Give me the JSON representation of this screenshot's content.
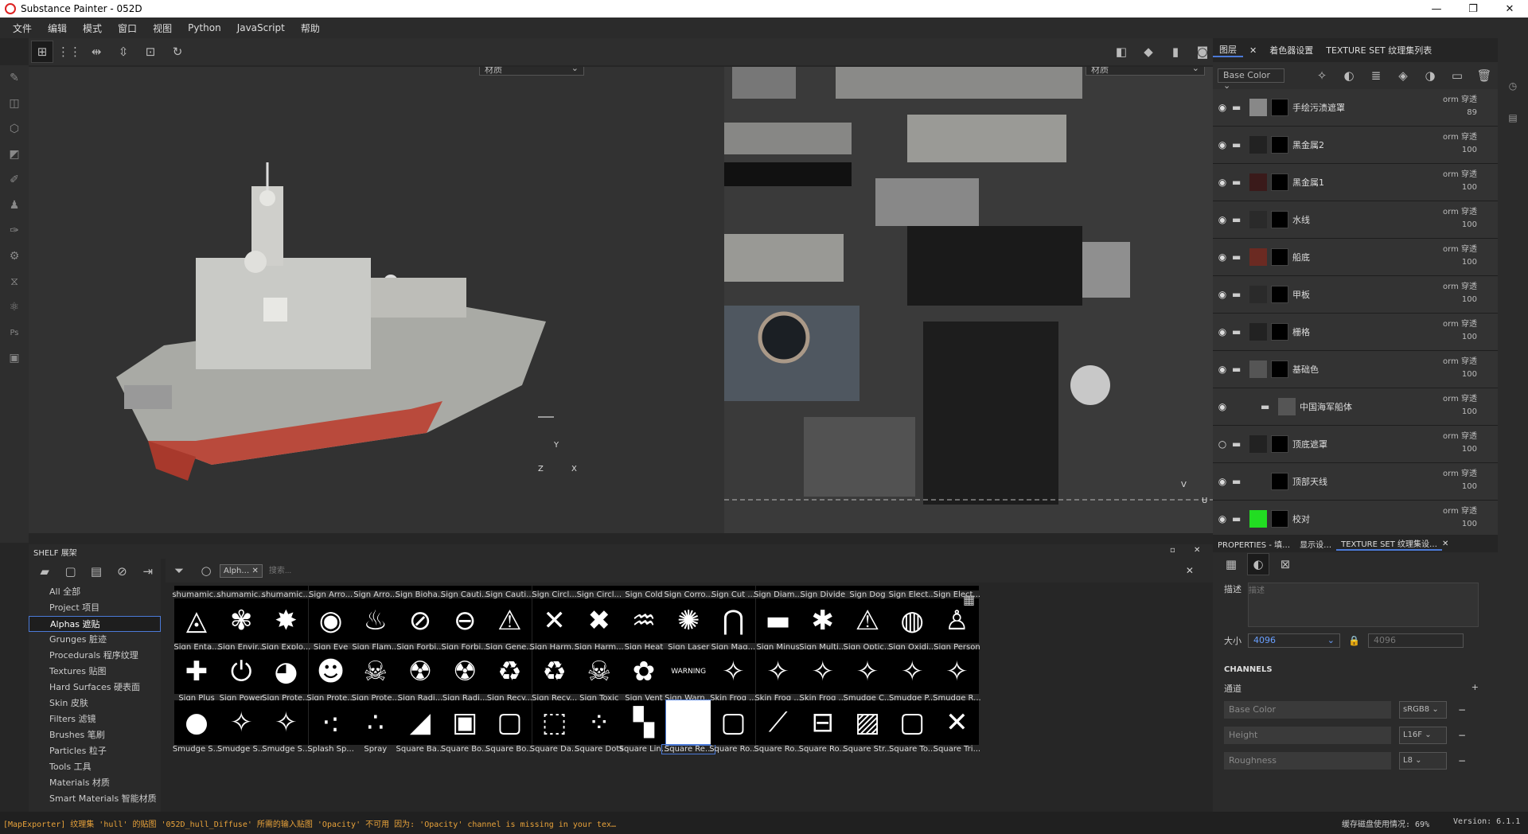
{
  "window": {
    "title": "Substance Painter - 052D"
  },
  "menu": [
    "文件",
    "编辑",
    "模式",
    "窗口",
    "视图",
    "Python",
    "JavaScript",
    "帮助"
  ],
  "viewport": {
    "material_select_3d": "材质",
    "material_select_2d": "材质",
    "axis_labels": [
      "Y",
      "Z",
      "X"
    ],
    "uv_axis": [
      "V",
      "U"
    ]
  },
  "layers_panel": {
    "tabs": [
      "图层",
      "着色器设置",
      "TEXTURE SET 纹理集列表"
    ],
    "channel_select": "Base Color",
    "layers": [
      {
        "name": "手绘污渍遮罩",
        "blend": "orm",
        "mode": "穿透",
        "opacity": "89"
      },
      {
        "name": "黑金属2",
        "blend": "orm",
        "mode": "穿透",
        "opacity": "100"
      },
      {
        "name": "黑金属1",
        "blend": "orm",
        "mode": "穿透",
        "opacity": "100"
      },
      {
        "name": "水线",
        "blend": "orm",
        "mode": "穿透",
        "opacity": "100"
      },
      {
        "name": "船底",
        "blend": "orm",
        "mode": "穿透",
        "opacity": "100"
      },
      {
        "name": "甲板",
        "blend": "orm",
        "mode": "穿透",
        "opacity": "100"
      },
      {
        "name": "栅格",
        "blend": "orm",
        "mode": "穿透",
        "opacity": "100"
      },
      {
        "name": "基础色",
        "blend": "orm",
        "mode": "穿透",
        "opacity": "100"
      },
      {
        "name": "中国海军船体",
        "blend": "orm",
        "mode": "穿透",
        "opacity": "100"
      },
      {
        "name": "顶底遮罩",
        "blend": "orm",
        "mode": "穿透",
        "opacity": "100"
      },
      {
        "name": "顶部天线",
        "blend": "orm",
        "mode": "穿透",
        "opacity": "100"
      },
      {
        "name": "校对",
        "blend": "orm",
        "mode": "穿透",
        "opacity": "100"
      }
    ]
  },
  "shelf": {
    "title": "SHELF 展架",
    "filter_tag": "Alph…",
    "search_placeholder": "搜索...",
    "categories": [
      "All 全部",
      "Project 项目",
      "Alphas 遮贴",
      "Grunges 脏迹",
      "Procedurals 程序纹理",
      "Textures 贴图",
      "Hard Surfaces 硬表面",
      "Skin 皮肤",
      "Filters 滤镜",
      "Brushes 笔刷",
      "Particles 粒子",
      "Tools 工具",
      "Materials 材质",
      "Smart Materials 智能材质"
    ],
    "selected_category": "Alphas 遮贴",
    "row0": [
      "shumamic...",
      "shumamic...",
      "shumamic...",
      "Sign Arro...",
      "Sign Arro...",
      "Sign Bioha...",
      "Sign Cauti...",
      "Sign Cauti...",
      "Sign Circl...",
      "Sign Circl...",
      "Sign Cold",
      "Sign Corro...",
      "Sign Cut ...",
      "Sign Diam...",
      "Sign Divide",
      "Sign Dog",
      "Sign Elect...",
      "Sign Elect..."
    ],
    "row1": [
      "Sign Enta...",
      "Sign Envir...",
      "Sign Explo...",
      "Sign Eye",
      "Sign Flam...",
      "Sign Forbi...",
      "Sign Forbi...",
      "Sign Gene...",
      "Sign Harm...",
      "Sign Harm...",
      "Sign Heat",
      "Sign Laser",
      "Sign Mag...",
      "Sign Minus",
      "Sign Multi...",
      "Sign Optic...",
      "Sign Oxidi...",
      "Sign Person"
    ],
    "row2": [
      "Sign Plus",
      "Sign Power",
      "Sign Prote...",
      "Sign Prote...",
      "Sign Prote...",
      "Sign Radi...",
      "Sign Radi...",
      "Sign Recy...",
      "Sign Recy...",
      "Sign Toxic",
      "Sign Vent",
      "Sign Warn...",
      "Skin Frog ...",
      "Skin Frog ...",
      "Skin Frog ...",
      "Smudge C...",
      "Smudge P...",
      "Smudge R..."
    ],
    "row3": [
      "Smudge S...",
      "Smudge S...",
      "Smudge S...",
      "Splash Sp...",
      "Spray",
      "Square Ba...",
      "Square Bo...",
      "Square Bo...",
      "Square Da...",
      "Square Dots",
      "Square Lin...",
      "Square Re...",
      "Square Ro...",
      "Square Ro...",
      "Square Ro...",
      "Square Str...",
      "Square To...",
      "Square Tri..."
    ],
    "icons1": [
      "◬",
      "✾",
      "✸",
      "◉",
      "♨",
      "⊘",
      "⊖",
      "⚠",
      "✕",
      "✖",
      "♒",
      "✺",
      "⋂",
      "▬",
      "✱",
      "⚠",
      "◍",
      "♙"
    ],
    "icons2": [
      "✚",
      "⏻",
      "◕",
      "☻",
      "☠",
      "☢",
      "☢",
      "♻",
      "♻",
      "☠",
      "✿",
      "WARNING",
      "✧",
      "✧",
      "✧",
      "✧",
      "✧",
      "✧"
    ]
  },
  "properties": {
    "tabs": [
      "PROPERTIES - 填…",
      "显示设…",
      "TEXTURE SET 纹理集设…"
    ],
    "desc_label": "描述",
    "desc_placeholder": "描述",
    "size_label": "大小",
    "size_value": "4096",
    "size_value2": "4096",
    "channels_title": "CHANNELS",
    "channels_sub": "通道",
    "channels": [
      {
        "name": "Base Color",
        "format": "sRGB8"
      },
      {
        "name": "Height",
        "format": "L16F"
      },
      {
        "name": "Roughness",
        "format": "L8"
      }
    ]
  },
  "status": {
    "message": "[MapExporter] 纹理集 'hull' 的贴图 '052D_hull_Diffuse' 所需的输入贴图 'Opacity' 不可用 因为: 'Opacity' channel is missing in your tex…",
    "cache": "缓存磁盘使用情况: 69%",
    "version": "Version: 6.1.1"
  }
}
